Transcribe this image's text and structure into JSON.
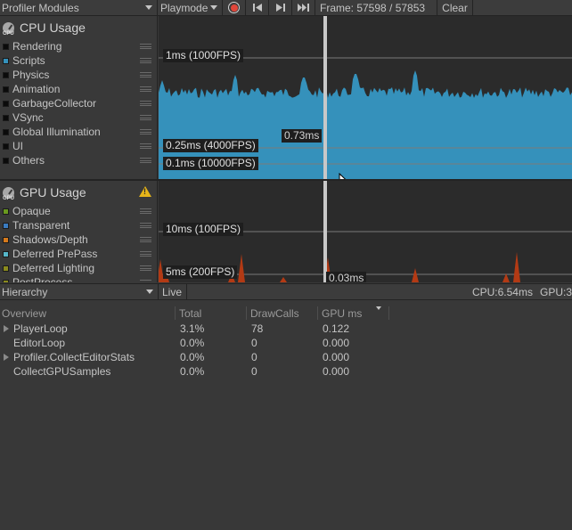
{
  "toolbar": {
    "modules_label": "Profiler Modules",
    "playmode_label": "Playmode",
    "frame_label": "Frame: 57598 / 57853",
    "clear_label": "Clear"
  },
  "cpu": {
    "title": "CPU Usage",
    "legend": [
      {
        "label": "Rendering",
        "color": "#0b0b0b"
      },
      {
        "label": "Scripts",
        "color": "#3591bb"
      },
      {
        "label": "Physics",
        "color": "#0b0b0b"
      },
      {
        "label": "Animation",
        "color": "#0b0b0b"
      },
      {
        "label": "GarbageCollector",
        "color": "#0b0b0b"
      },
      {
        "label": "VSync",
        "color": "#0b0b0b"
      },
      {
        "label": "Global Illumination",
        "color": "#0b0b0b"
      },
      {
        "label": "UI",
        "color": "#0b0b0b"
      },
      {
        "label": "Others",
        "color": "#0b0b0b"
      }
    ],
    "ref_lines": [
      "1ms (1000FPS)",
      "0.25ms (4000FPS)",
      "0.1ms (10000FPS)"
    ],
    "selected_value": "0.73ms",
    "fill_color": "#3591bb"
  },
  "gpu": {
    "title": "GPU Usage",
    "legend": [
      {
        "label": "Opaque",
        "color": "#6a9a1f"
      },
      {
        "label": "Transparent",
        "color": "#3a7bbf"
      },
      {
        "label": "Shadows/Depth",
        "color": "#d67a1c"
      },
      {
        "label": "Deferred PrePass",
        "color": "#56b6c9"
      },
      {
        "label": "Deferred Lighting",
        "color": "#8a8a1e"
      },
      {
        "label": "PostProcess",
        "color": "#8a8a1e"
      }
    ],
    "ref_lines": [
      "10ms (100FPS)",
      "5ms (200FPS)"
    ],
    "selected_value": "0.03ms",
    "fill_color": "#b33a14"
  },
  "hierarchy": {
    "view_label": "Hierarchy",
    "live_label": "Live",
    "cpu_time": "CPU:6.54ms",
    "gpu_time": "GPU:3",
    "columns": [
      "Overview",
      "Total",
      "DrawCalls",
      "GPU ms"
    ],
    "rows": [
      {
        "name": "PlayerLoop",
        "total": "3.1%",
        "drawcalls": "78",
        "gpu_ms": "0.122",
        "expandable": true
      },
      {
        "name": "EditorLoop",
        "total": "0.0%",
        "drawcalls": "0",
        "gpu_ms": "0.000",
        "expandable": false
      },
      {
        "name": "Profiler.CollectEditorStats",
        "total": "0.0%",
        "drawcalls": "0",
        "gpu_ms": "0.000",
        "expandable": true
      },
      {
        "name": "CollectGPUSamples",
        "total": "0.0%",
        "drawcalls": "0",
        "gpu_ms": "0.000",
        "expandable": false
      }
    ]
  }
}
